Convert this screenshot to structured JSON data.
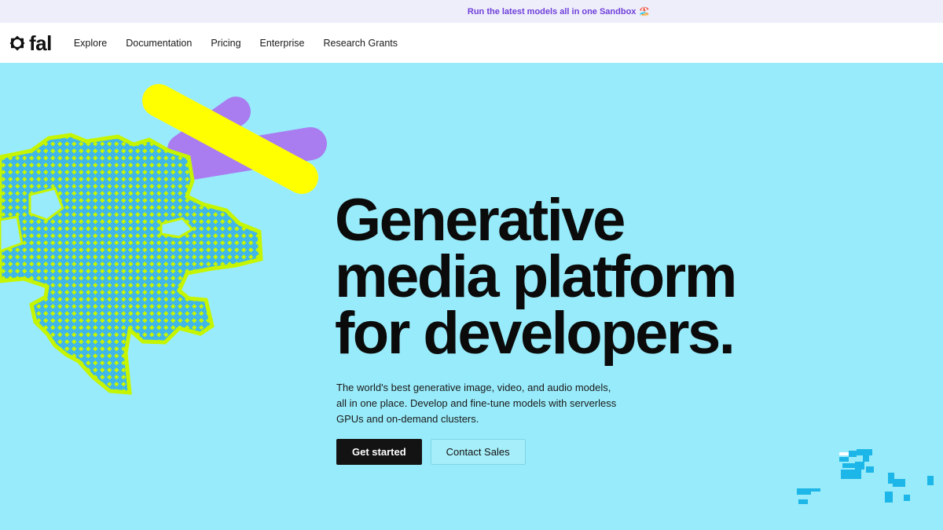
{
  "announcement": {
    "text": "Run the latest models all in one Sandbox",
    "emoji": "🏖️"
  },
  "nav": {
    "logo_text": "fal",
    "items": [
      "Explore",
      "Documentation",
      "Pricing",
      "Enterprise",
      "Research Grants"
    ]
  },
  "hero": {
    "headline": [
      "Generative",
      "media platform",
      "for developers."
    ],
    "subtext": "The world's best generative image, video, and audio models, all in one place. Develop and fine-tune models with serverless GPUs and on-demand clusters.",
    "primary_cta": "Get started",
    "secondary_cta": "Contact Sales"
  },
  "colors": {
    "background": "#98ebfa",
    "announcement_bg": "#eeeefb",
    "announcement_text": "#6f3fd9",
    "yellow_shape": "#ffff00",
    "purple_shape": "#a97df0",
    "creature_fill": "#3fb7e8",
    "creature_dots": "#c6f500",
    "pixel_accent": "#1cb6e8"
  }
}
